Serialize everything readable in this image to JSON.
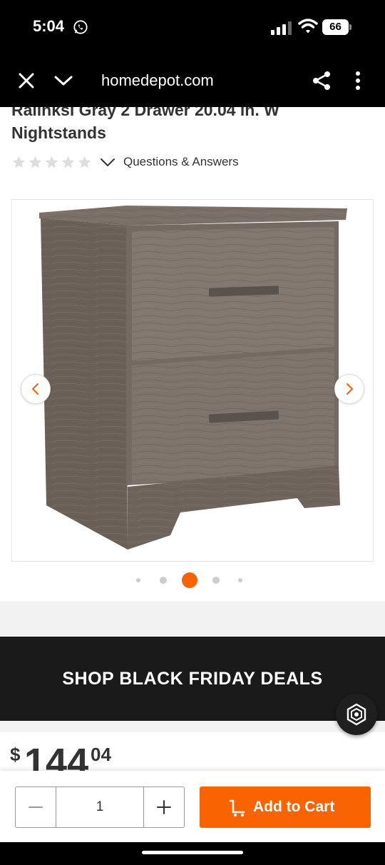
{
  "status_bar": {
    "time": "5:04",
    "battery": "66"
  },
  "browser": {
    "url": "homedepot.com"
  },
  "product": {
    "title": "Ralinksi Gray 2 Drawer 20.04 in. W Nightstands",
    "qa_label": "Questions & Answers",
    "rating_stars": 5,
    "rating_filled": 0
  },
  "gallery": {
    "dots": 5,
    "active_dot": 2
  },
  "promo": {
    "label": "SHOP BLACK FRIDAY DEALS"
  },
  "price": {
    "symbol": "$",
    "dollars": "144",
    "cents": "04"
  },
  "cart": {
    "quantity": "1",
    "add_label": "Add to Cart"
  },
  "colors": {
    "accent": "#f96302",
    "promo_bg": "#1a1a1a",
    "text": "#333333"
  }
}
